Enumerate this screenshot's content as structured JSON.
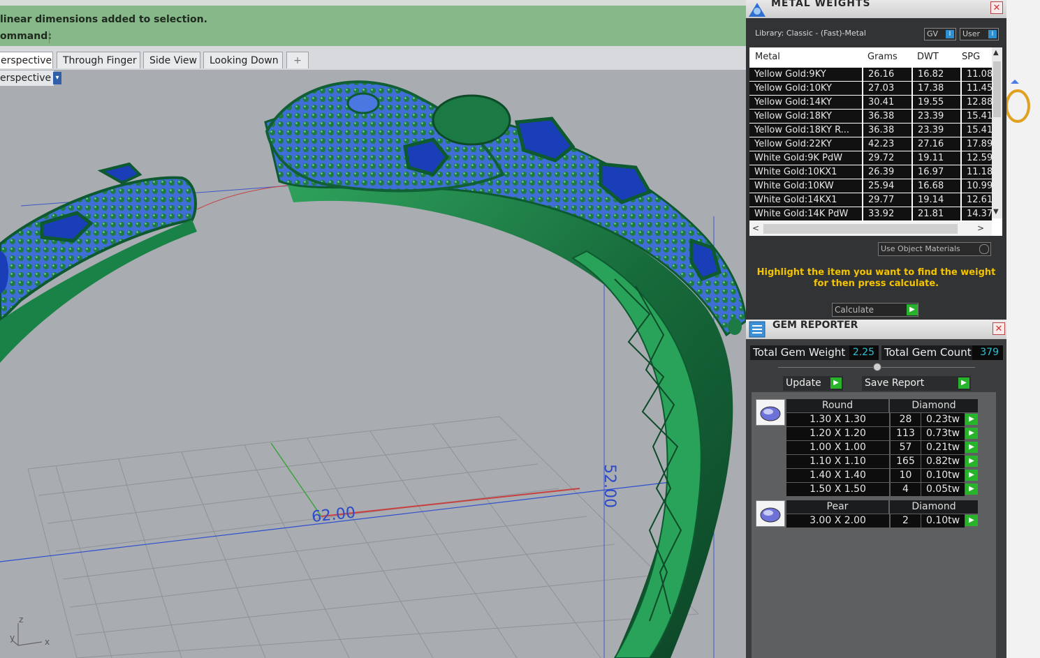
{
  "command_area": {
    "message": "linear dimensions added to selection.",
    "prompt": "ommand:"
  },
  "viewport_tabs": [
    {
      "label": "erspective",
      "active": true
    },
    {
      "label": "Through Finger",
      "active": false
    },
    {
      "label": "Side View",
      "active": false
    },
    {
      "label": "Looking Down",
      "active": false
    }
  ],
  "viewport": {
    "label": "erspective",
    "dimension_width": "62.00",
    "dimension_height": "52.00",
    "axis_z": "z",
    "axis_x": "x",
    "axis_y": "y"
  },
  "metal_weights": {
    "title": "METAL WEIGHTS",
    "library": "Library: Classic - (Fast)-Metal",
    "toggle_gv": "GV",
    "toggle_user": "User",
    "columns": [
      "Metal",
      "Grams",
      "DWT",
      "SPG"
    ],
    "rows": [
      [
        "Yellow Gold:9KY",
        "26.16",
        "16.82",
        "11.08"
      ],
      [
        "Yellow Gold:10KY",
        "27.03",
        "17.38",
        "11.45"
      ],
      [
        "Yellow Gold:14KY",
        "30.41",
        "19.55",
        "12.88"
      ],
      [
        "Yellow Gold:18KY",
        "36.38",
        "23.39",
        "15.41"
      ],
      [
        "Yellow Gold:18KY R...",
        "36.38",
        "23.39",
        "15.41"
      ],
      [
        "Yellow Gold:22KY",
        "42.23",
        "27.16",
        "17.89"
      ],
      [
        "White Gold:9K PdW",
        "29.72",
        "19.11",
        "12.59"
      ],
      [
        "White Gold:10KX1",
        "26.39",
        "16.97",
        "11.18"
      ],
      [
        "White Gold:10KW",
        "25.94",
        "16.68",
        "10.99"
      ],
      [
        "White Gold:14KX1",
        "29.77",
        "19.14",
        "12.61"
      ],
      [
        "White Gold:14K PdW",
        "33.92",
        "21.81",
        "14.37"
      ]
    ],
    "use_object_materials": "Use Object Materials",
    "instruction_line1": "Highlight the item you want to find the weight",
    "instruction_line2": "for then press calculate.",
    "calculate_label": "Calculate"
  },
  "gem_reporter": {
    "title": "GEM REPORTER",
    "total_weight_label": "Total Gem Weight",
    "total_weight": "2.25",
    "total_count_label": "Total Gem Count",
    "total_count": "379",
    "update_label": "Update",
    "save_label": "Save Report",
    "groups": [
      {
        "shape": "Round",
        "material": "Diamond",
        "rows": [
          [
            "1.30 X 1.30",
            "28",
            "0.23tw"
          ],
          [
            "1.20 X 1.20",
            "113",
            "0.73tw"
          ],
          [
            "1.00 X 1.00",
            "57",
            "0.21tw"
          ],
          [
            "1.10 X 1.10",
            "165",
            "0.82tw"
          ],
          [
            "1.40 X 1.40",
            "10",
            "0.10tw"
          ],
          [
            "1.50 X 1.50",
            "4",
            "0.05tw"
          ]
        ]
      },
      {
        "shape": "Pear",
        "material": "Diamond",
        "rows": [
          [
            "3.00 X 2.00",
            "2",
            "0.10tw"
          ]
        ]
      }
    ]
  },
  "colors": {
    "command_bg": "#86b889",
    "viewport_bg": "#a9acb0",
    "ring_green": "#1f8a4c",
    "gem_blue": "#3a5fd8",
    "panel_bg": "#313334",
    "instruction_yellow": "#f5c400",
    "value_cyan": "#29c4d6",
    "button_green": "#27b42b"
  }
}
